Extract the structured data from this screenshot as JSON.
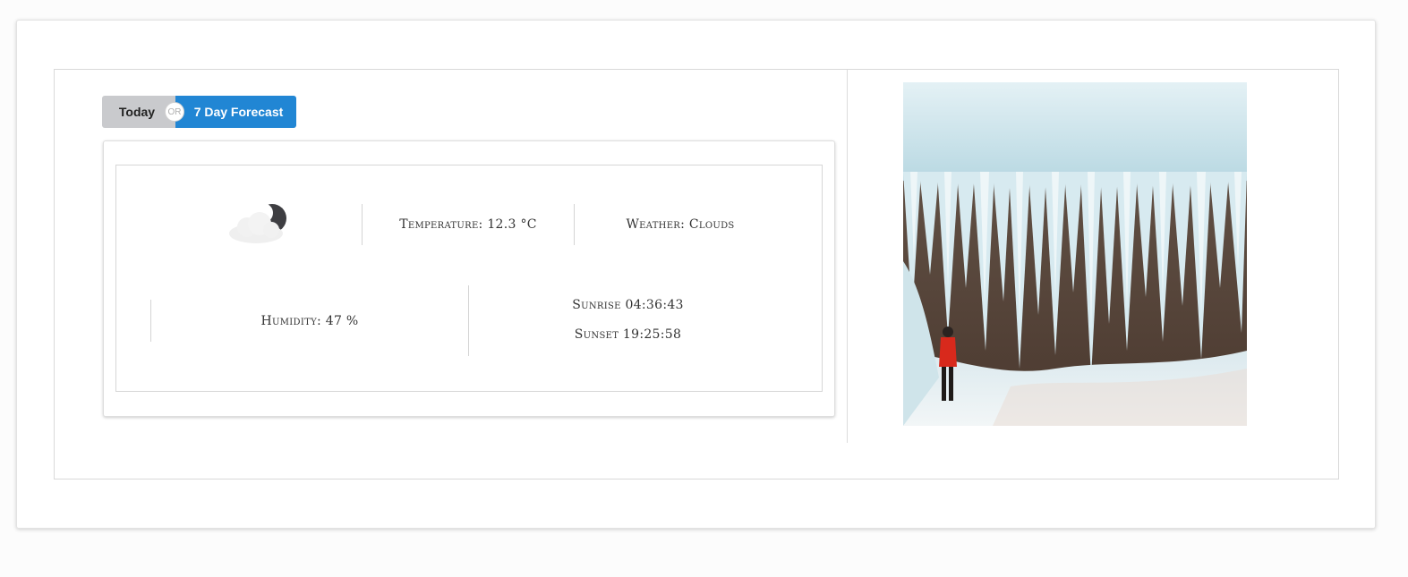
{
  "toggle": {
    "today_label": "Today",
    "or_label": "OR",
    "forecast_label": "7 Day Forecast"
  },
  "weather": {
    "icon": "cloud-moon-icon",
    "temperature_text": "Temperature: 12.3 °C",
    "condition_text": "Weather: Clouds",
    "humidity_text": "Humidity: 47 %",
    "sunrise_text": "Sunrise 04:36:43",
    "sunset_text": "Sunset 19:25:58"
  },
  "photo": {
    "subject": "frozen-waterfall-icicles-photo"
  },
  "colors": {
    "today_bg": "#c9cacd",
    "forecast_bg": "#2186d4",
    "jacket_red": "#d8291c"
  }
}
